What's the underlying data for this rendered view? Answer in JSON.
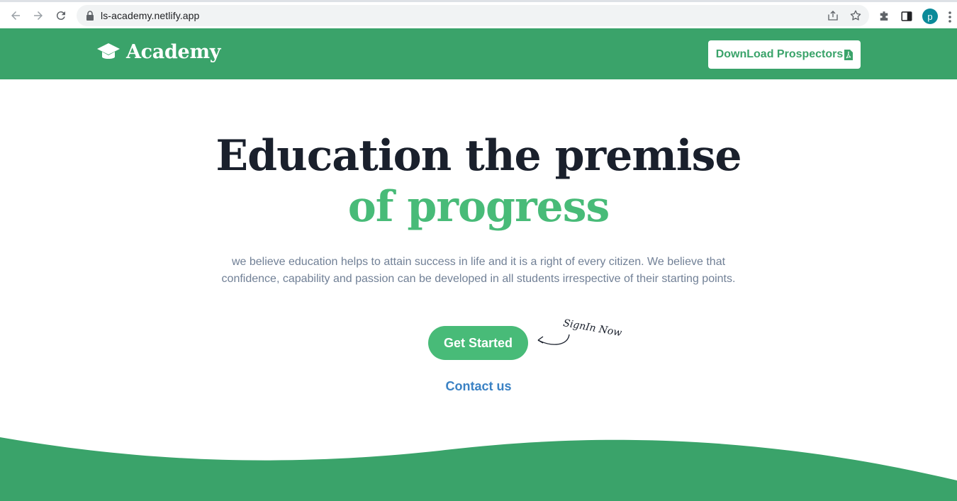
{
  "browser": {
    "url": "ls-academy.netlify.app",
    "profile_initial": "p"
  },
  "header": {
    "brand_name": "Academy",
    "download_label": "DownLoad Prospectors"
  },
  "hero": {
    "title_line1": "Education the premise",
    "title_line2": "of progress",
    "description": "we believe education helps to attain success in life and it is a right of every citizen. We believe that confidence, capability and passion can be developed in all students irrespective of their starting points.",
    "cta_label": "Get Started",
    "signin_note": "SignIn Now",
    "contact_label": "Contact us"
  },
  "colors": {
    "header_green": "#3aa36a",
    "accent_green": "#48bb78",
    "title_dark": "#1a202c",
    "link_blue": "#3b82c4",
    "text_gray": "#718096"
  },
  "icons": {
    "brand": "graduation-cap-icon",
    "download": "pdf-file-icon"
  }
}
